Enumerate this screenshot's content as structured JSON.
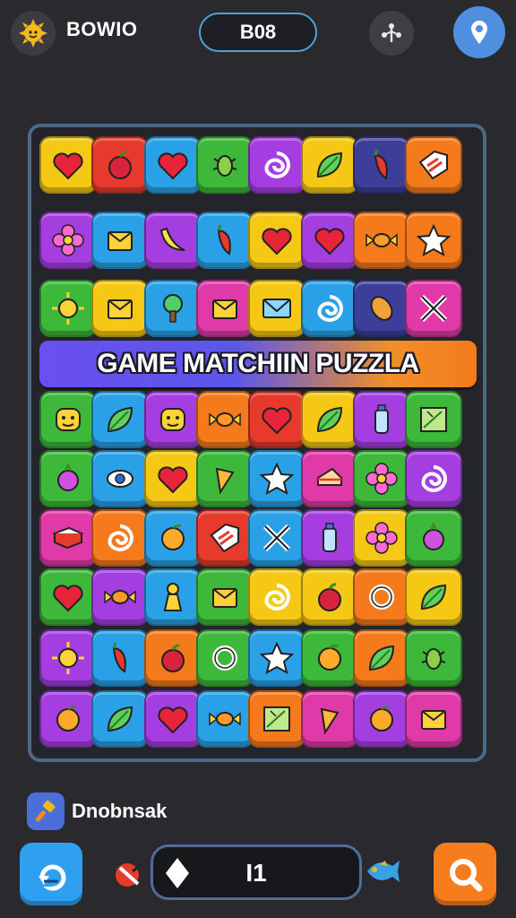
{
  "header": {
    "player_name": "BOWIO",
    "score": "B08"
  },
  "banner": {
    "title": "GAME MATCHIIN PUZZLA"
  },
  "footer": {
    "hint_label": "Dnobnsak",
    "moves": "I1"
  },
  "colors": {
    "yellow": "#f4c814",
    "red": "#e53a2c",
    "blue": "#2aa0e6",
    "green": "#3db83a",
    "purple": "#a43ee0",
    "orange": "#f47a1c",
    "pink": "#e03aa8",
    "navy": "#3c3e9a"
  },
  "board": {
    "rows": [
      [
        {
          "c": "yellow",
          "i": "heart-icon"
        },
        {
          "c": "red",
          "i": "apple-icon"
        },
        {
          "c": "blue",
          "i": "heart-icon"
        },
        {
          "c": "green",
          "i": "bug-icon"
        },
        {
          "c": "purple",
          "i": "swirl-icon"
        },
        {
          "c": "yellow",
          "i": "leaf-icon"
        },
        {
          "c": "navy",
          "i": "pepper-icon"
        },
        {
          "c": "orange",
          "i": "tag-icon"
        }
      ],
      [
        {
          "c": "purple",
          "i": "flower-icon"
        },
        {
          "c": "blue",
          "i": "box-icon"
        },
        {
          "c": "purple",
          "i": "banana-icon"
        },
        {
          "c": "blue",
          "i": "pepper-icon"
        },
        {
          "c": "yellow",
          "i": "heart-icon"
        },
        {
          "c": "purple",
          "i": "heart-icon"
        },
        {
          "c": "orange",
          "i": "candy-icon"
        },
        {
          "c": "orange",
          "i": "star-icon"
        }
      ],
      [
        {
          "c": "green",
          "i": "sun-icon"
        },
        {
          "c": "yellow",
          "i": "box-icon"
        },
        {
          "c": "blue",
          "i": "tree-icon"
        },
        {
          "c": "pink",
          "i": "box-icon"
        },
        {
          "c": "yellow",
          "i": "envelope-icon"
        },
        {
          "c": "blue",
          "i": "swirl-icon"
        },
        {
          "c": "navy",
          "i": "seed-icon"
        },
        {
          "c": "pink",
          "i": "cross-icon"
        }
      ],
      [
        {
          "c": "green",
          "i": "face-icon"
        },
        {
          "c": "blue",
          "i": "leaf-icon"
        },
        {
          "c": "purple",
          "i": "face-icon"
        },
        {
          "c": "orange",
          "i": "candy-icon"
        },
        {
          "c": "red",
          "i": "heart-icon"
        },
        {
          "c": "yellow",
          "i": "leaf-icon"
        },
        {
          "c": "purple",
          "i": "bottle-icon"
        },
        {
          "c": "green",
          "i": "map-icon"
        }
      ],
      [
        {
          "c": "green",
          "i": "berry-icon"
        },
        {
          "c": "blue",
          "i": "eye-icon"
        },
        {
          "c": "yellow",
          "i": "heart-icon"
        },
        {
          "c": "green",
          "i": "carrot-icon"
        },
        {
          "c": "blue",
          "i": "star-icon"
        },
        {
          "c": "pink",
          "i": "cake-icon"
        },
        {
          "c": "green",
          "i": "flower-icon"
        },
        {
          "c": "purple",
          "i": "swirl-icon"
        }
      ],
      [
        {
          "c": "pink",
          "i": "book-icon"
        },
        {
          "c": "orange",
          "i": "swirl-icon"
        },
        {
          "c": "blue",
          "i": "orange-icon"
        },
        {
          "c": "red",
          "i": "tag-icon"
        },
        {
          "c": "blue",
          "i": "cross-icon"
        },
        {
          "c": "purple",
          "i": "bottle-icon"
        },
        {
          "c": "yellow",
          "i": "flower-icon"
        },
        {
          "c": "green",
          "i": "berry-icon"
        }
      ],
      [
        {
          "c": "green",
          "i": "heart-icon"
        },
        {
          "c": "purple",
          "i": "candy-icon"
        },
        {
          "c": "blue",
          "i": "pawn-icon"
        },
        {
          "c": "green",
          "i": "box-icon"
        },
        {
          "c": "yellow",
          "i": "swirl-icon"
        },
        {
          "c": "yellow",
          "i": "apple-icon"
        },
        {
          "c": "orange",
          "i": "ring-icon"
        },
        {
          "c": "yellow",
          "i": "leaf-icon"
        }
      ],
      [
        {
          "c": "purple",
          "i": "sun-icon"
        },
        {
          "c": "blue",
          "i": "pepper-icon"
        },
        {
          "c": "orange",
          "i": "apple-icon"
        },
        {
          "c": "green",
          "i": "ring-icon"
        },
        {
          "c": "blue",
          "i": "star-icon"
        },
        {
          "c": "green",
          "i": "orange-icon"
        },
        {
          "c": "orange",
          "i": "leaf-icon"
        },
        {
          "c": "green",
          "i": "bug-icon"
        }
      ],
      [
        {
          "c": "purple",
          "i": "orange-icon"
        },
        {
          "c": "blue",
          "i": "leaf-icon"
        },
        {
          "c": "purple",
          "i": "heart-icon"
        },
        {
          "c": "blue",
          "i": "candy-icon"
        },
        {
          "c": "orange",
          "i": "map-icon"
        },
        {
          "c": "pink",
          "i": "carrot-icon"
        },
        {
          "c": "purple",
          "i": "orange-icon"
        },
        {
          "c": "pink",
          "i": "box-icon"
        }
      ]
    ]
  }
}
